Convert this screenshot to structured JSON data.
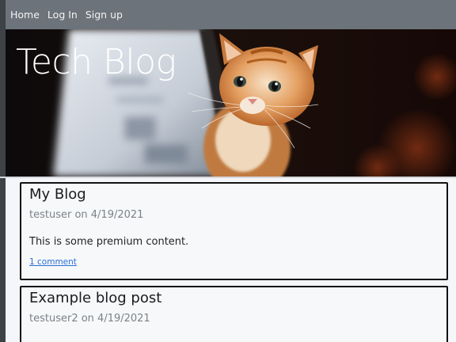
{
  "nav": {
    "items": [
      "Home",
      "Log In",
      "Sign up"
    ]
  },
  "hero": {
    "title": "Tech Blog",
    "image": "kitten-with-laptop"
  },
  "posts": [
    {
      "title": "My Blog",
      "author": "testuser",
      "date": "4/19/2021",
      "meta": "testuser on 4/19/2021",
      "content": "This is some premium content.",
      "comments_label": "1 comment"
    },
    {
      "title": "Example blog post",
      "author": "testuser2",
      "date": "4/19/2021",
      "meta": "testuser2 on 4/19/2021"
    }
  ],
  "colors": {
    "nav_bg": "#6c737a",
    "page_bg": "#f4f6f9",
    "link": "#2b6fd6",
    "card_border": "#111111"
  }
}
